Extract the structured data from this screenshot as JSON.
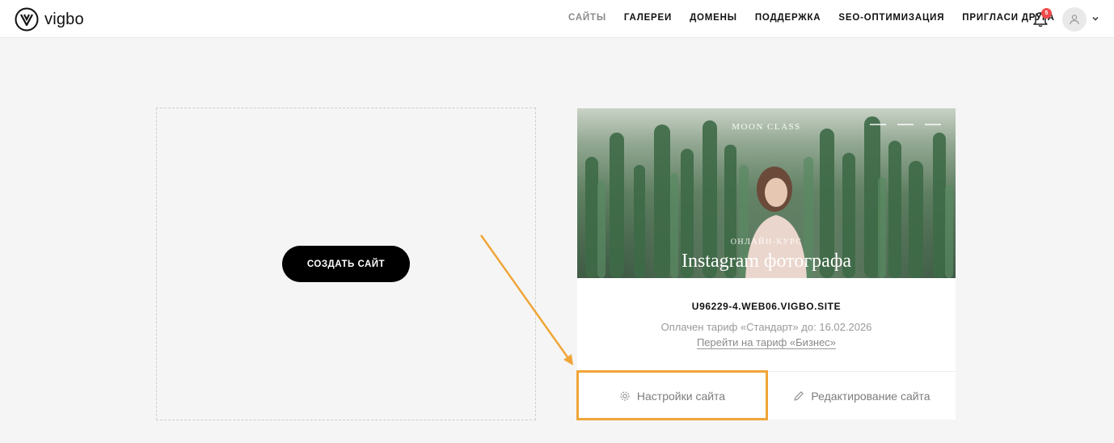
{
  "header": {
    "logo_text": "vigbo",
    "nav": [
      "САЙТЫ",
      "ГАЛЕРЕИ",
      "ДОМЕНЫ",
      "ПОДДЕРЖКА",
      "SEO-ОПТИМИЗАЦИЯ",
      "ПРИГЛАСИ ДРУГА"
    ],
    "active_nav": "САЙТЫ",
    "notifications_count": "5",
    "icons": [
      "vigbo-logo-icon",
      "bell-icon",
      "user-icon",
      "chevron-down-icon"
    ]
  },
  "create": {
    "button_label": "СОЗДАТЬ САЙТ"
  },
  "site_card": {
    "preview": {
      "brand": "MOON CLASS",
      "subtitle": "ОНЛАЙН-КУРС",
      "title": "Instagram фотографа"
    },
    "domain": "U96229-4.WEB06.VIGBO.SITE",
    "tariff": "Оплачен тариф «Стандарт» до: 16.02.2026",
    "upgrade_link": "Перейти на тариф «Бизнес»",
    "settings_label": "Настройки сайта",
    "edit_label": "Редактирование сайта",
    "icons": [
      "gear-icon",
      "pencil-icon"
    ]
  },
  "colors": {
    "accent_orange": "#f0a538",
    "badge_red": "#ef4a4a",
    "background": "#f5f5f5"
  }
}
